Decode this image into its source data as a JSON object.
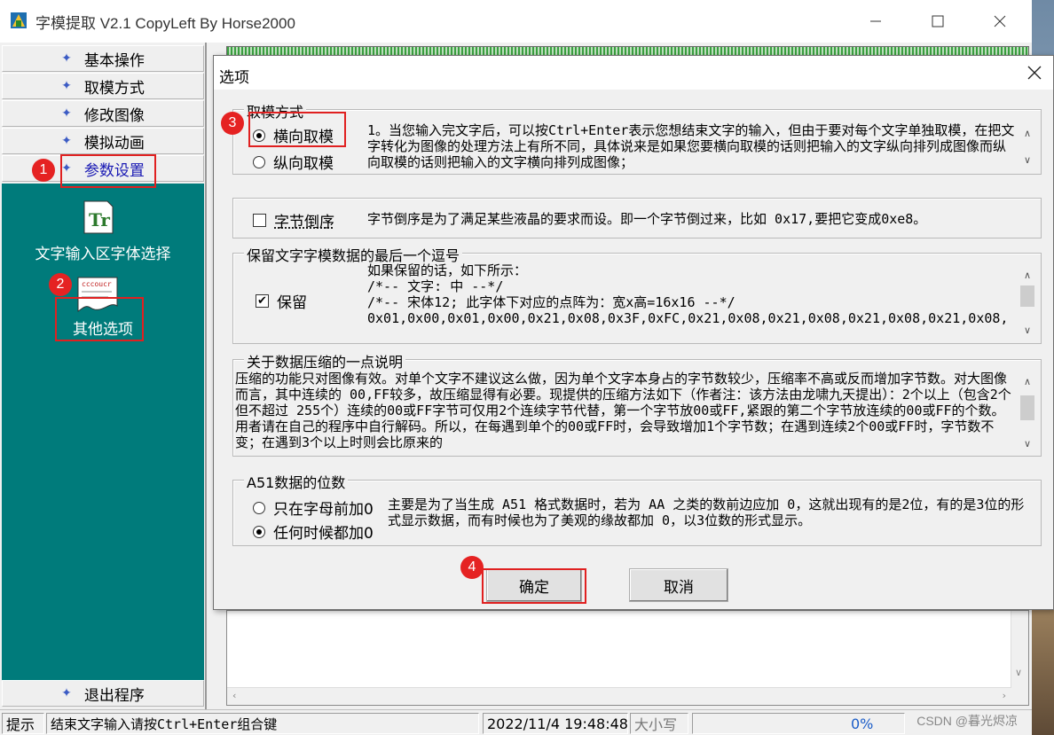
{
  "window": {
    "title": "字模提取 V2.1  CopyLeft By Horse2000",
    "minimize_icon": "minimize-icon",
    "maximize_icon": "maximize-icon",
    "close_icon": "close-icon"
  },
  "sidebar": {
    "items": [
      {
        "label": "基本操作"
      },
      {
        "label": "取模方式"
      },
      {
        "label": "修改图像"
      },
      {
        "label": "模拟动画"
      },
      {
        "label": "参数设置"
      }
    ],
    "exit_label": "退出程序",
    "panel": {
      "font_select_label": "文字输入区字体选择",
      "other_options_label": "其他选项",
      "font_icon_text": "Tr"
    }
  },
  "statusbar": {
    "hint_label": "提示",
    "hint_text": "结束文字输入请按Ctrl+Enter组合键",
    "datetime": "2022/11/4 19:48:48",
    "caps": "大小写",
    "progress": "0%",
    "watermark": "CSDN @暮光烬凉"
  },
  "dialog": {
    "title": "选项",
    "mode_group": {
      "legend": "取模方式",
      "horizontal_label": "横向取模",
      "vertical_label": "纵向取模",
      "selected": "horizontal",
      "description": "1。当您输入完文字后，可以按Ctrl+Enter表示您想结束文字的输入，但由于要对每个文字单独取模，在把文字转化为图像的处理方法上有所不同，具体说来是如果您要横向取模的话则把输入的文字纵向排列成图像而纵向取模的话则把输入的文字横向排列成图像；"
    },
    "byte_reverse": {
      "label": "字节倒序",
      "checked": false,
      "description": "字节倒序是为了满足某些液晶的要求而设。即一个字节倒过来，比如 0x17,要把它变成0xe8。"
    },
    "keep_comma": {
      "legend": "保留文字字模数据的最后一个逗号",
      "label": "保留",
      "checked": true,
      "lines": [
        "如果保留的话，如下所示：",
        "/*--  文字:  中  --*/",
        "/*--  宋体12;  此字体下对应的点阵为：宽x高=16x16   --*/",
        "0x01,0x00,0x01,0x00,0x21,0x08,0x3F,0xFC,0x21,0x08,0x21,0x08,0x21,0x08,0x21,0x08,"
      ]
    },
    "compression": {
      "legend": "关于数据压缩的一点说明",
      "text": "压缩的功能只对图像有效。对单个文字不建议这么做，因为单个文字本身占的字节数较少，压缩率不高或反而增加字节数。对大图像而言，其中连续的 00,FF较多，故压缩显得有必要。现提供的压缩方法如下（作者注：该方法由龙啸九天提出）：2个以上（包含2个但不超过 255个）连续的00或FF字节可仅用2个连续字节代替，第一个字节放00或FF,紧跟的第二个字节放连续的00或FF的个数。用者请在自己的程序中自行解码。所以，在每遇到单个的00或FF时，会导致增加1个字节数；在遇到连续2个00或FF时，字节数不变；在遇到3个以上时则会比原来的"
    },
    "a51": {
      "legend": "A51数据的位数",
      "option1": "只在字母前加0",
      "option2": "任何时候都加0",
      "selected": "option2",
      "description": "主要是为了当生成 A51 格式数据时，若为 AA 之类的数前边应加 0，这就出现有的是2位，有的是3位的形式显示数据，而有时候也为了美观的缘故都加 0，以3位数的形式显示。"
    },
    "ok_label": "确定",
    "cancel_label": "取消"
  },
  "annotations": {
    "badge1": "1",
    "badge2": "2",
    "badge3": "3",
    "badge4": "4",
    "color": "#e02020"
  },
  "colors": {
    "panel_teal": "#007b7b",
    "nav_diamond": "#3b5bc4"
  }
}
